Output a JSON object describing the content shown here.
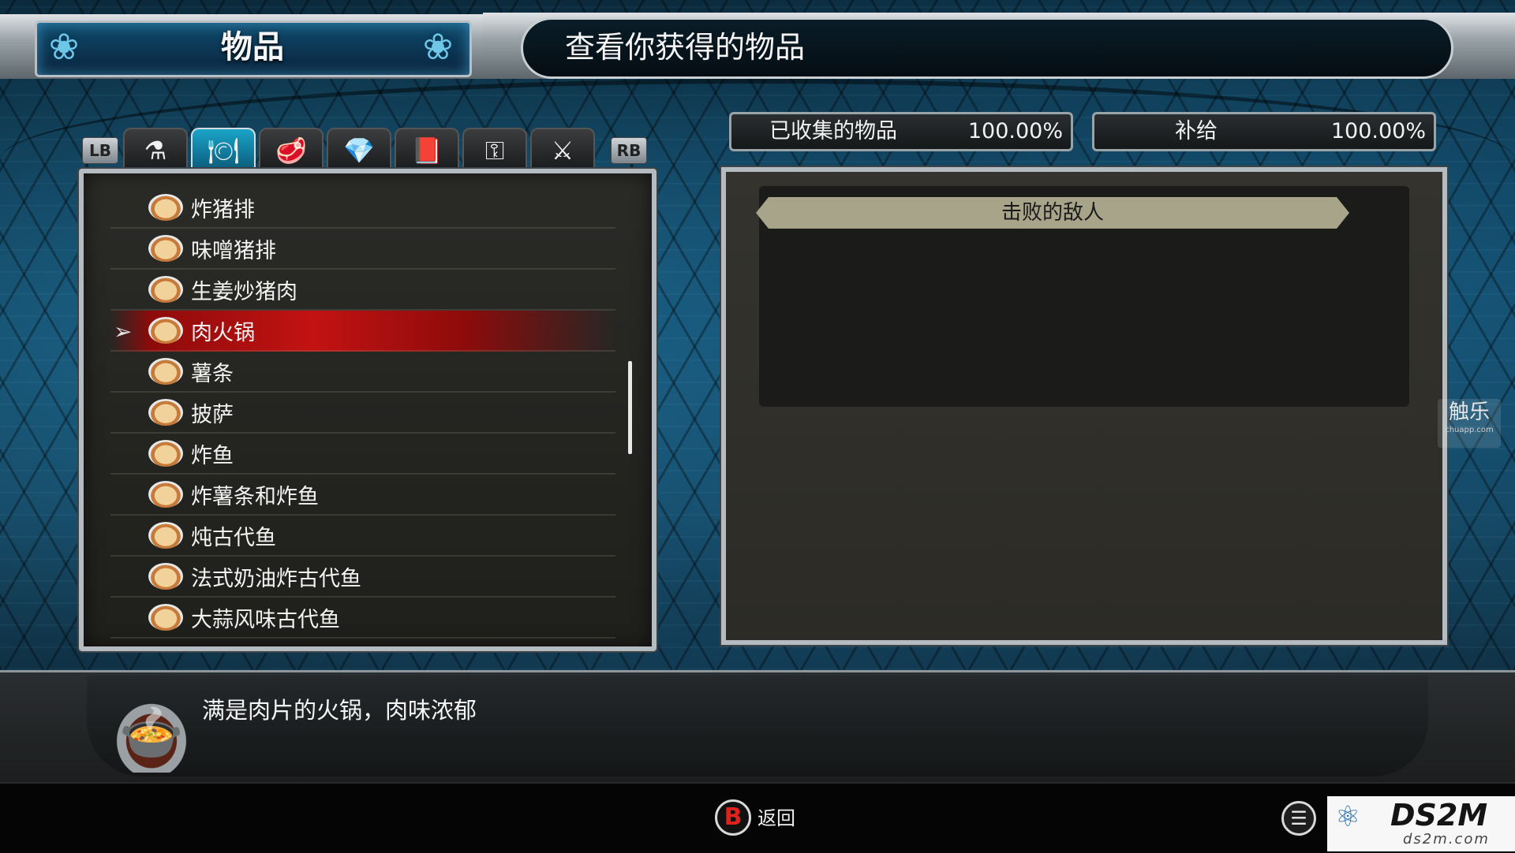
{
  "header": {
    "title": "物品",
    "subtitle": "查看你获得的物品"
  },
  "tabs": {
    "lb": "LB",
    "rb": "RB",
    "items": [
      {
        "icon": "potion-icon",
        "glyph": "⚗"
      },
      {
        "icon": "plate-icon",
        "glyph": "🍽"
      },
      {
        "icon": "meat-icon",
        "glyph": "🥩"
      },
      {
        "icon": "crystal-icon",
        "glyph": "💎"
      },
      {
        "icon": "book-icon",
        "glyph": "📕"
      },
      {
        "icon": "key-icon",
        "glyph": "⚿"
      },
      {
        "icon": "crossed-swords-icon",
        "glyph": "⚔"
      }
    ],
    "active_index": 1
  },
  "list": {
    "items": [
      "炸猪排",
      "味噌猪排",
      "生姜炒猪肉",
      "肉火锅",
      "薯条",
      "披萨",
      "炸鱼",
      "炸薯条和炸鱼",
      "炖古代鱼",
      "法式奶油炸古代鱼",
      "大蒜风味古代鱼"
    ],
    "selected_index": 3
  },
  "stats": {
    "collected_label": "已收集的物品",
    "collected_value": "100.00%",
    "supply_label": "补给",
    "supply_value": "100.00%"
  },
  "detail": {
    "ribbon": "击败的敌人"
  },
  "description": {
    "text": "满是肉片的火锅，肉味浓郁"
  },
  "footer": {
    "b_button": "B",
    "back_label": "返回"
  },
  "watermarks": {
    "chuapp_cn": "触乐",
    "chuapp_url": "chuapp.com",
    "ds2m_name": "DS2M",
    "ds2m_url": "ds2m.com"
  },
  "colors": {
    "accent_red": "#c31212",
    "panel_border": "#b4bcc1",
    "tab_active": "#1aa4c9"
  }
}
